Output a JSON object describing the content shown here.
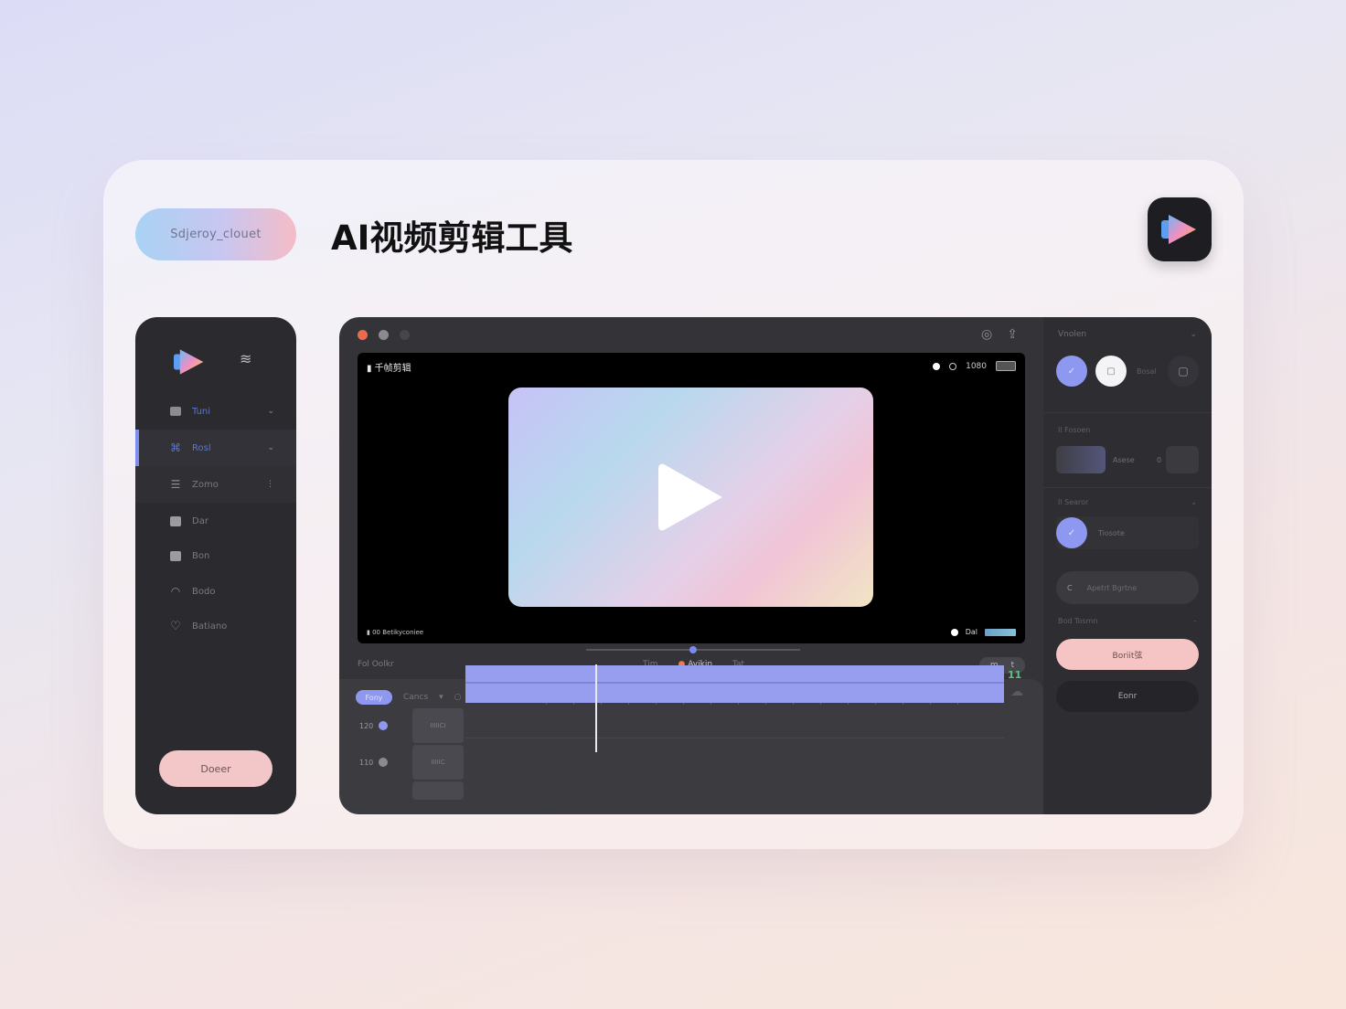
{
  "header": {
    "pill_label": "Sdjeroy_clouet",
    "title": "AI视频剪辑工具",
    "app_icon": "play-logo-icon"
  },
  "sidebar": {
    "logo": "play-logo-icon",
    "menu_icon": "menu-lines-icon",
    "items": [
      {
        "label": "Tuni",
        "icon": "square-icon",
        "chevron": "chevron-down-icon"
      },
      {
        "label": "Rosl",
        "icon": "gift-icon",
        "chevron": "chevron-down-icon"
      },
      {
        "label": "Zomo",
        "icon": "list-icon",
        "chevron": "more-icon"
      },
      {
        "label": "Dar",
        "icon": "image-icon"
      },
      {
        "label": "Bon",
        "icon": "check-box-icon"
      },
      {
        "label": "Bodo",
        "icon": "wifi-icon"
      },
      {
        "label": "Batiano",
        "icon": "heart-icon"
      }
    ],
    "bottom_button": "Doeer"
  },
  "editor": {
    "window_dots": [
      "#ef6a4c",
      "#8a8a8f",
      "#46464b"
    ],
    "preview": {
      "label": "千帧剪辑",
      "top_right": "1080",
      "foot_left": "00 Betikyconiee",
      "foot_right": "Dal"
    },
    "controls": {
      "left": "Fol Oolkr",
      "items": [
        "Tim",
        "Ayikin",
        "Tat"
      ],
      "right_a": "m",
      "right_b": "t"
    },
    "timeline": {
      "chip": "Fony",
      "label": "Cancs",
      "tracks": [
        {
          "label": "120",
          "thumb": "IIIIICI"
        },
        {
          "label": "110",
          "thumb": "IIIIIC"
        }
      ],
      "marker": "11"
    },
    "right_panel": {
      "title": "Vnolen",
      "toggle_label": "Bosal",
      "section1": "Il Fosoen",
      "field1": "Asese",
      "field1_value": "0",
      "section2": "Il Searor",
      "option1": "Tiosote",
      "input_prefix": "C",
      "input_placeholder": "Apetrt Bgrtne",
      "section3": "Bod Tosmn",
      "primary_button": "Boriit弦",
      "secondary_button": "Eonr"
    }
  },
  "colors": {
    "accent": "#8e98f0",
    "pink": "#f5c4c4",
    "dark": "#2b2b2f"
  }
}
